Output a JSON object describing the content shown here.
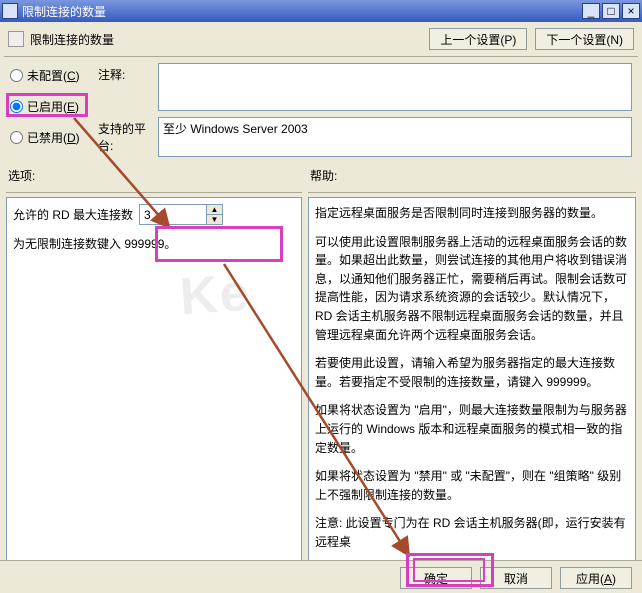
{
  "window": {
    "title": "限制连接的数量",
    "header_title": "限制连接的数量",
    "min": "_",
    "max": "□",
    "close": "×"
  },
  "nav": {
    "prev": "上一个设置(P)",
    "next": "下一个设置(N)"
  },
  "radios": {
    "not_configured": "未配置(",
    "not_configured_k": "C",
    "enabled": "已启用(",
    "enabled_k": "E",
    "disabled": "已禁用(",
    "disabled_k": "D",
    "close_paren": ")"
  },
  "fields": {
    "comment_label": "注释:",
    "comment_value": "",
    "platform_label": "支持的平台:",
    "platform_value": "至少 Windows Server 2003"
  },
  "cols": {
    "options": "选项:",
    "help": "帮助:"
  },
  "options": {
    "max_conn_label": "允许的 RD 最大连接数",
    "max_conn_value": "3",
    "unlimited_hint": "为无限制连接数键入 999999。"
  },
  "help": {
    "p1": "指定远程桌面服务是否限制同时连接到服务器的数量。",
    "p2": "可以使用此设置限制服务器上活动的远程桌面服务会话的数量。如果超出此数量，则尝试连接的其他用户将收到错误消息，以通知他们服务器正忙，需要稍后再试。限制会话数可提高性能，因为请求系统资源的会话较少。默认情况下，RD 会话主机服务器不限制远程桌面服务会话的数量，并且管理远程桌面允许两个远程桌面服务会话。",
    "p3": "若要使用此设置，请输入希望为服务器指定的最大连接数量。若要指定不受限制的连接数量，请键入 999999。",
    "p4": "如果将状态设置为 \"启用\"，则最大连接数量限制为与服务器上运行的 Windows 版本和远程桌面服务的模式相一致的指定数量。",
    "p5": "如果将状态设置为 \"禁用\" 或 \"未配置\"，则在 \"组策略\" 级别上不强制限制连接的数量。",
    "p6": "注意: 此设置专门为在 RD 会话主机服务器(即，运行安装有远程桌"
  },
  "footer": {
    "ok": "确定",
    "cancel": "取消",
    "apply": "应用(",
    "apply_k": "A",
    "close_paren": ")"
  },
  "watermark": "Ke"
}
